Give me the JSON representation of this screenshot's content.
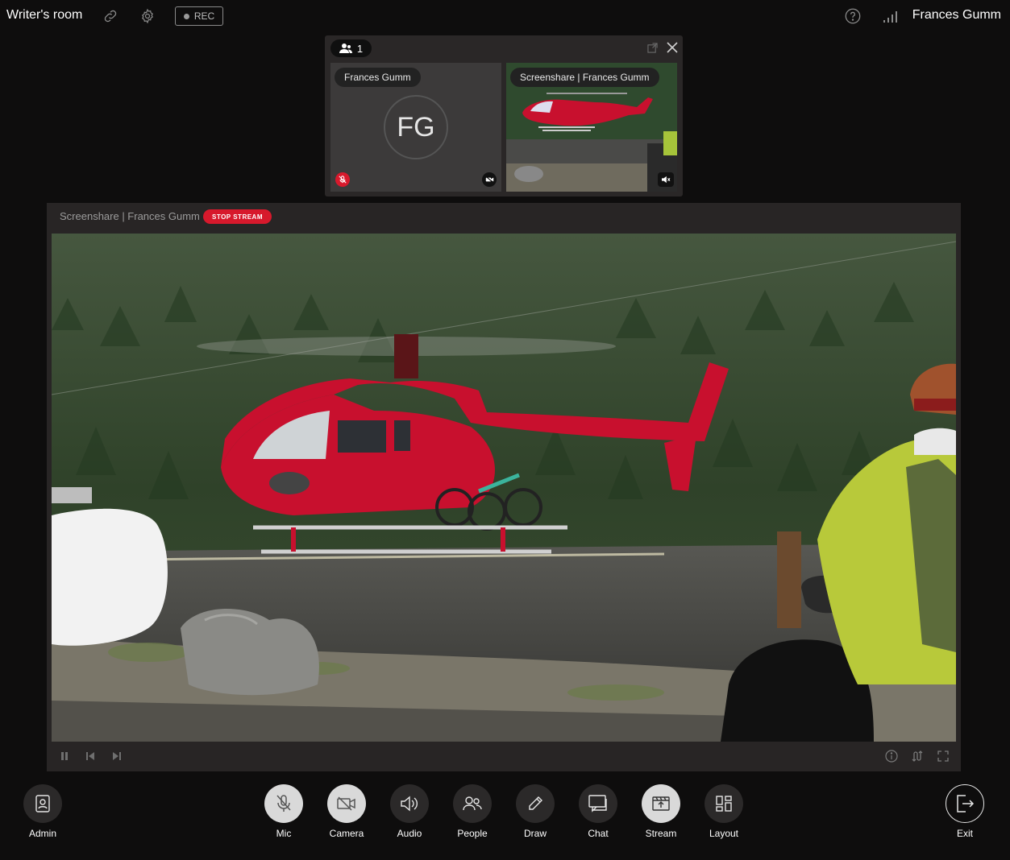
{
  "header": {
    "room_title": "Writer's room",
    "rec_label": "REC",
    "user_name": "Frances Gumm"
  },
  "participants": {
    "count": "1",
    "tiles": [
      {
        "label": "Frances Gumm",
        "initials": "FG"
      },
      {
        "label": "Screenshare | Frances Gumm"
      }
    ]
  },
  "stream": {
    "label": "Screenshare | Frances Gumm",
    "stop_label": "STOP STREAM"
  },
  "toolbar": {
    "admin": "Admin",
    "mic": "Mic",
    "camera": "Camera",
    "audio": "Audio",
    "people": "People",
    "draw": "Draw",
    "chat": "Chat",
    "stream": "Stream",
    "layout": "Layout",
    "exit": "Exit"
  },
  "colors": {
    "background": "#0e0d0d",
    "accent_red": "#d7192c",
    "panel": "#282525"
  }
}
